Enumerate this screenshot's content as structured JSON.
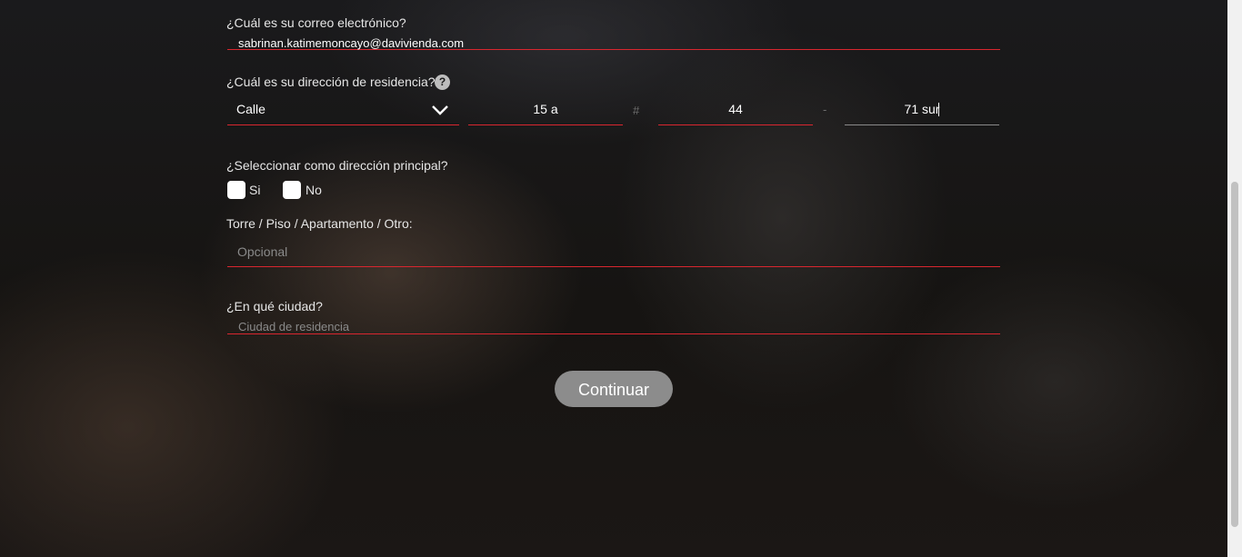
{
  "form": {
    "email": {
      "label": "¿Cuál es su correo electrónico?",
      "value": "sabrinan.katimemoncayo@davivienda.com"
    },
    "address": {
      "label": "¿Cuál es su dirección de residencia?",
      "help_icon": "?",
      "street_type": "Calle",
      "number1": "15 a",
      "hash_symbol": "#",
      "number2": "44",
      "dash_symbol": "-",
      "number3": "71 sur"
    },
    "primary": {
      "label": "¿Seleccionar como dirección principal?",
      "yes_label": "Si",
      "no_label": "No"
    },
    "tower": {
      "label": "Torre / Piso / Apartamento / Otro:",
      "placeholder": "Opcional"
    },
    "city": {
      "label": "¿En qué ciudad?",
      "placeholder": "Ciudad de residencia"
    },
    "continue_label": "Continuar"
  },
  "colors": {
    "accent_red": "#d9262f",
    "button_gray": "#8c8c8c"
  }
}
